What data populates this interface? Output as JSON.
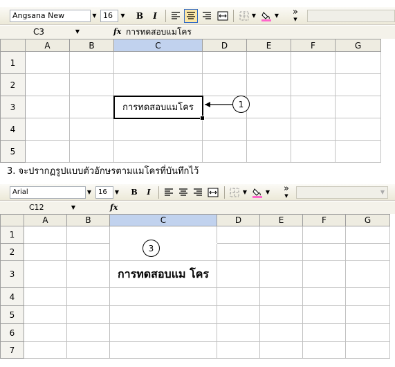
{
  "top": {
    "toolbar": {
      "font_name": "Angsana New",
      "font_size": "16",
      "bold_label": "B",
      "italic_label": "I",
      "overflow_label": "»"
    },
    "formula_bar": {
      "cell_ref": "C3",
      "fx_label": "fx",
      "content": "การทดสอบแมโคร"
    },
    "columns": [
      "A",
      "B",
      "C",
      "D",
      "E",
      "F",
      "G"
    ],
    "rows": [
      "1",
      "2",
      "3",
      "4",
      "5"
    ],
    "cell_c3": "การทดสอบแมโคร",
    "callout_number": "1"
  },
  "caption": "3.  จะปรากฏรูปแบบตัวอักษรตามแมโครที่บันทึกไว้",
  "bottom": {
    "toolbar": {
      "font_name": "Arial",
      "font_size": "16",
      "bold_label": "B",
      "italic_label": "I",
      "overflow_label": "»"
    },
    "formula_bar": {
      "cell_ref": "C12",
      "fx_label": "fx",
      "content": ""
    },
    "columns": [
      "A",
      "B",
      "C",
      "D",
      "E",
      "F",
      "G"
    ],
    "rows": [
      "1",
      "2",
      "3",
      "4",
      "5",
      "6",
      "7"
    ],
    "cell_c3": "การทดสอบแม โคร",
    "callout_number": "3"
  },
  "colors": {
    "selected_header": "#c1d2ee",
    "toolbar_active": "#fce7a7",
    "fill_underline": "#ff66cc"
  }
}
